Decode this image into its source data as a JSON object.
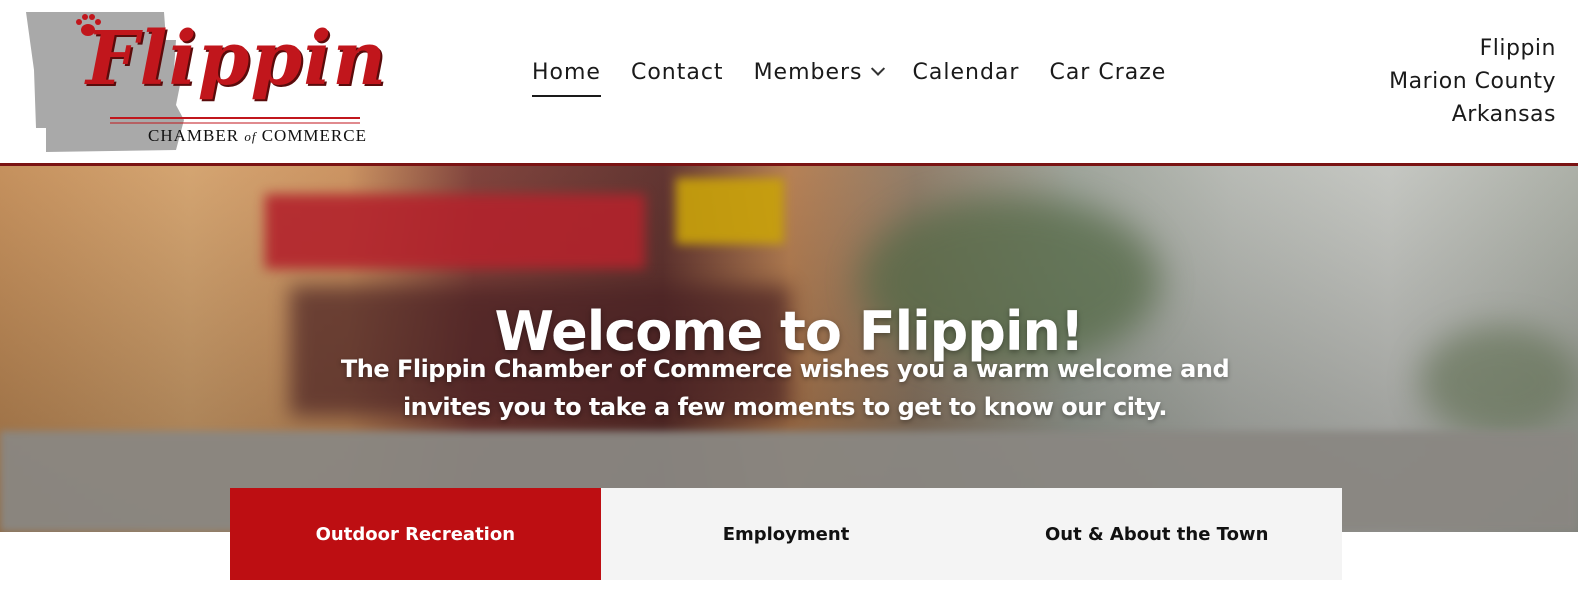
{
  "logo": {
    "brand": "Flippin",
    "sub_left": "CHAMBER",
    "sub_of": "of",
    "sub_right": "COMMERCE",
    "icon": "paw-print-icon",
    "brand_color": "#c1161c"
  },
  "nav": {
    "items": [
      {
        "label": "Home",
        "active": true
      },
      {
        "label": "Contact"
      },
      {
        "label": "Members",
        "has_dropdown": true
      },
      {
        "label": "Calendar"
      },
      {
        "label": "Car Craze"
      }
    ]
  },
  "location": {
    "line1": "Flippin",
    "line2": "Marion County",
    "line3": "Arkansas"
  },
  "hero": {
    "title": "Welcome to Flippin!",
    "subtitle": "The Flippin Chamber of Commerce wishes you a warm welcome and invites you to take a few moments to get to know our city."
  },
  "tabs": [
    {
      "label": "Outdoor Recreation",
      "active": true
    },
    {
      "label": "Employment"
    },
    {
      "label": "Out & About the Town"
    }
  ],
  "colors": {
    "accent": "#bd0e12",
    "header_border": "#7a1313",
    "tab_bg": "#f4f4f4"
  }
}
